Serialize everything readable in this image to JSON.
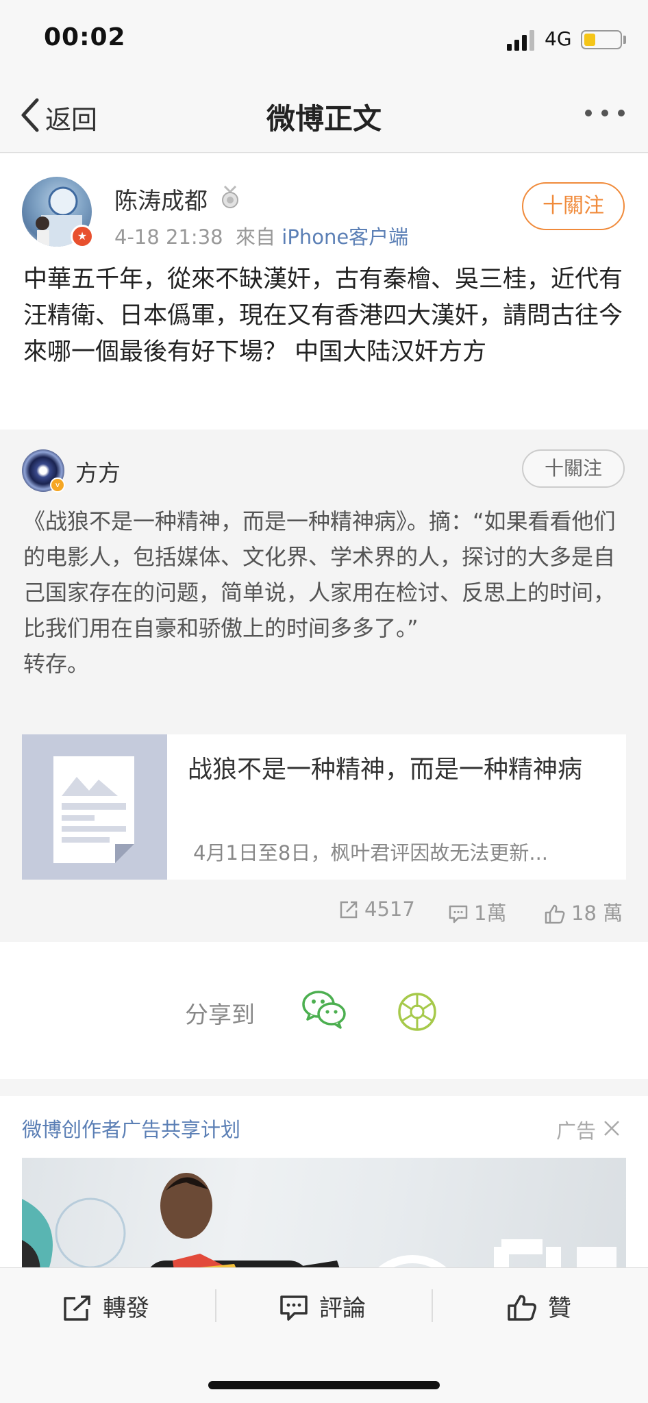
{
  "status_bar": {
    "time": "00:02",
    "network": "4G",
    "battery_level": 0.3
  },
  "nav": {
    "back_label": "返回",
    "title": "微博正文"
  },
  "post": {
    "author": "陈涛成都",
    "timestamp": "4-18 21:38",
    "source_prefix": "來自",
    "source": "iPhone客户端",
    "follow_label": "十關注",
    "text": "中華五千年，從來不缺漢奸，古有秦檜、吳三桂，近代有汪精衛、日本僞軍，現在又有香港四大漢奸，請問古往今來哪一個最後有好下場？ 中国大陆汉奸方方"
  },
  "retweet": {
    "author": "方方",
    "follow_label": "十關注",
    "text": "《战狼不是一种精神，而是一种精神病》。摘：“如果看看他们的电影人，包括媒体、文化界、学术界的人，探讨的大多是自己国家存在的问题，简单说，人家用在检讨、反思上的时间，比我们用在自豪和骄傲上的时间多多了。”",
    "text2": "转存。",
    "card": {
      "title": "战狼不是一种精神，而是一种精神病",
      "desc": "4月1日至8日，枫叶君评因故无法更新..."
    },
    "stats": {
      "reposts": "4517",
      "comments": "1萬",
      "likes": "18 萬"
    }
  },
  "share": {
    "label": "分享到"
  },
  "ad": {
    "title": "微博创作者广告共享计划",
    "tag": "广告"
  },
  "toolbar": {
    "repost": "轉發",
    "comment": "評論",
    "like": "贊"
  },
  "colors": {
    "accent_orange": "#f08a3a",
    "link_blue": "#5b7fb5",
    "wechat_green": "#4caf50",
    "moments_green": "#a6c94a"
  }
}
